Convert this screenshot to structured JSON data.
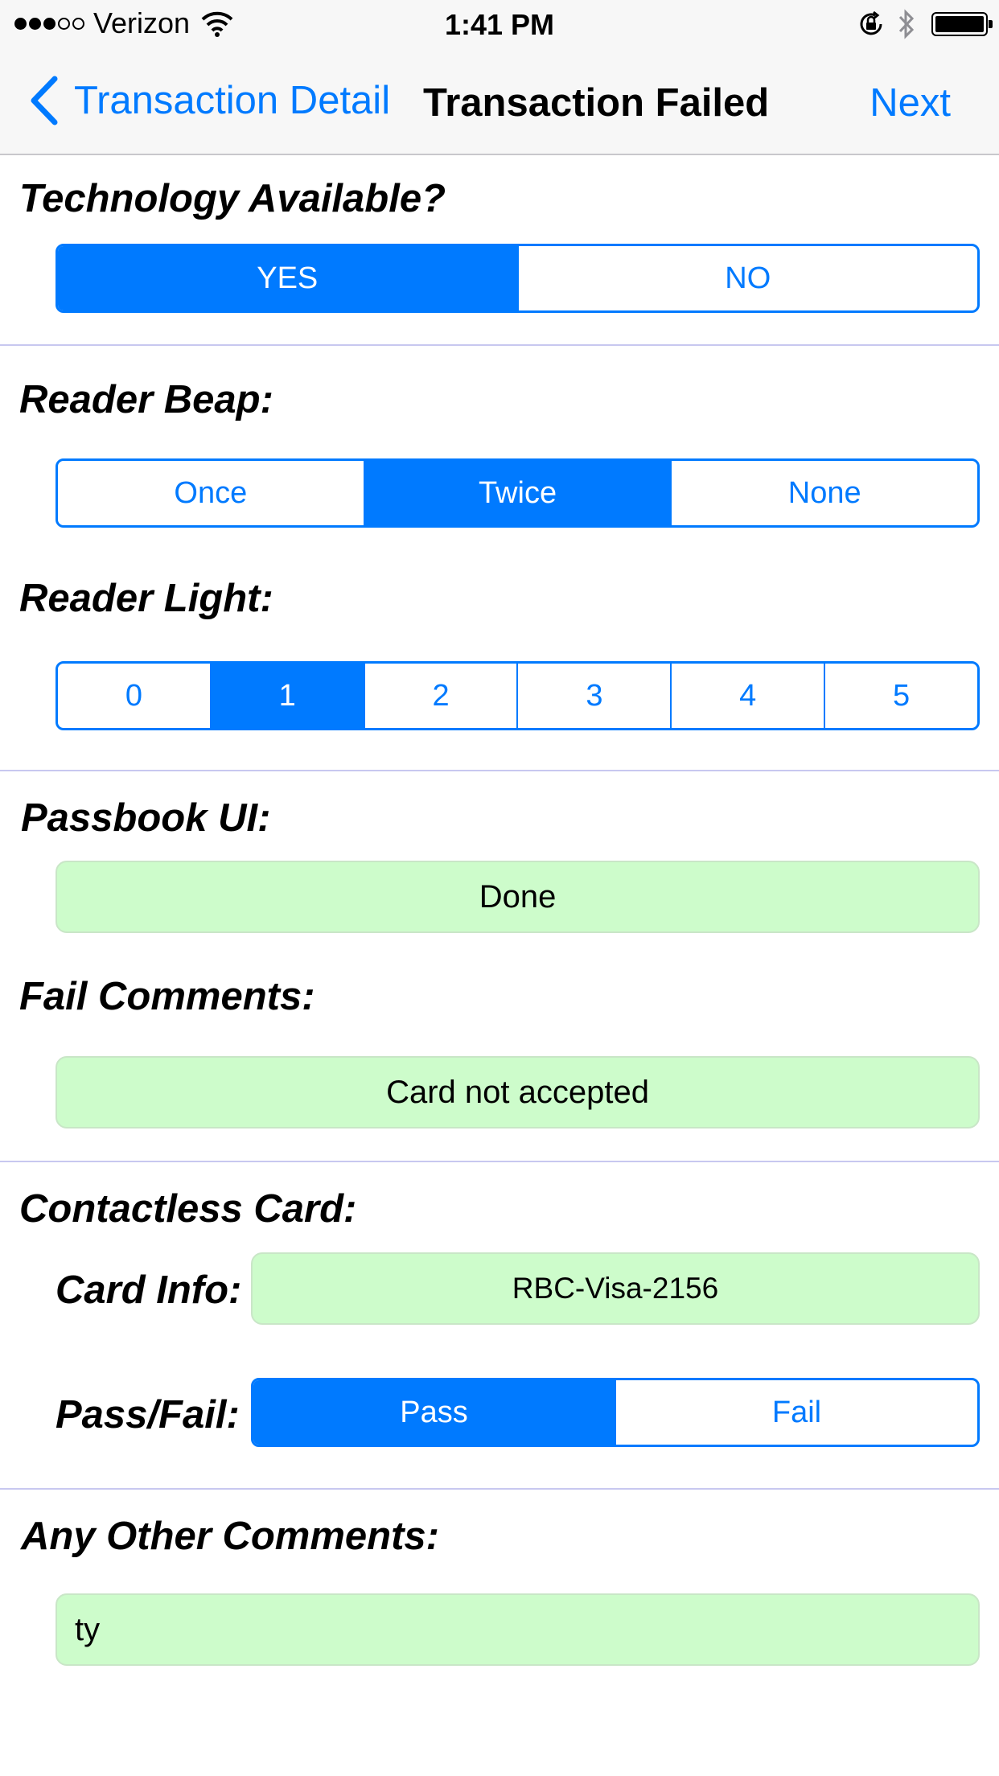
{
  "status_bar": {
    "signal_dots_filled": 3,
    "signal_dots_total": 5,
    "carrier": "Verizon",
    "time": "1:41 PM"
  },
  "nav": {
    "back_label": "Transaction Detail",
    "title": "Transaction Failed",
    "next_label": "Next"
  },
  "technology": {
    "label": "Technology Available?",
    "options": [
      "YES",
      "NO"
    ],
    "selected": "YES"
  },
  "reader_beap": {
    "label": "Reader Beap:",
    "options": [
      "Once",
      "Twice",
      "None"
    ],
    "selected": "Twice"
  },
  "reader_light": {
    "label": "Reader Light:",
    "options": [
      "0",
      "1",
      "2",
      "3",
      "4",
      "5"
    ],
    "selected": "1"
  },
  "passbook": {
    "label": "Passbook UI:",
    "value": "Done"
  },
  "fail_comments": {
    "label": "Fail Comments:",
    "value": "Card not accepted"
  },
  "contactless": {
    "label": "Contactless Card:",
    "card_info_label": "Card Info:",
    "card_info_value": "RBC-Visa-2156",
    "pass_fail_label": "Pass/Fail:",
    "pass_fail_options": [
      "Pass",
      "Fail"
    ],
    "pass_fail_selected": "Pass"
  },
  "other_comments": {
    "label": "Any Other Comments:",
    "value": "ty"
  },
  "colors": {
    "accent": "#007aff",
    "field_bg": "#cdfccb",
    "divider": "#c8c8f0"
  }
}
